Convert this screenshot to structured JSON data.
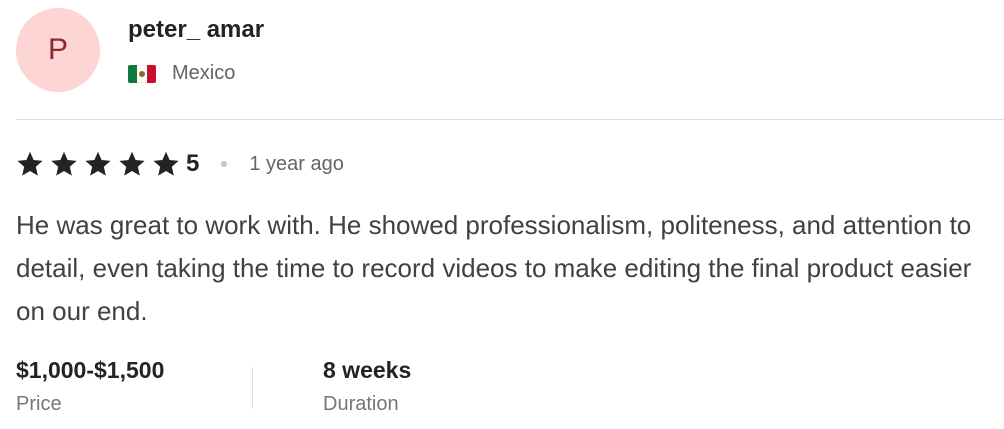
{
  "reviewer": {
    "avatar_initial": "P",
    "name": "peter_ amar",
    "country": "Mexico",
    "flag_icon": "mexico-flag-icon"
  },
  "rating": {
    "stars": 5,
    "value": "5",
    "time_ago": "1 year ago"
  },
  "review": {
    "text": "He was great to work with. He showed professionalism, politeness, and attention to detail, even taking the time to record videos to make editing the final product easier on our end."
  },
  "details": {
    "price_value": "$1,000-$1,500",
    "price_label": "Price",
    "duration_value": "8 weeks",
    "duration_label": "Duration"
  },
  "colors": {
    "avatar_bg": "#fdd5d5",
    "avatar_text": "#8a2a2a",
    "star": "#222325"
  }
}
